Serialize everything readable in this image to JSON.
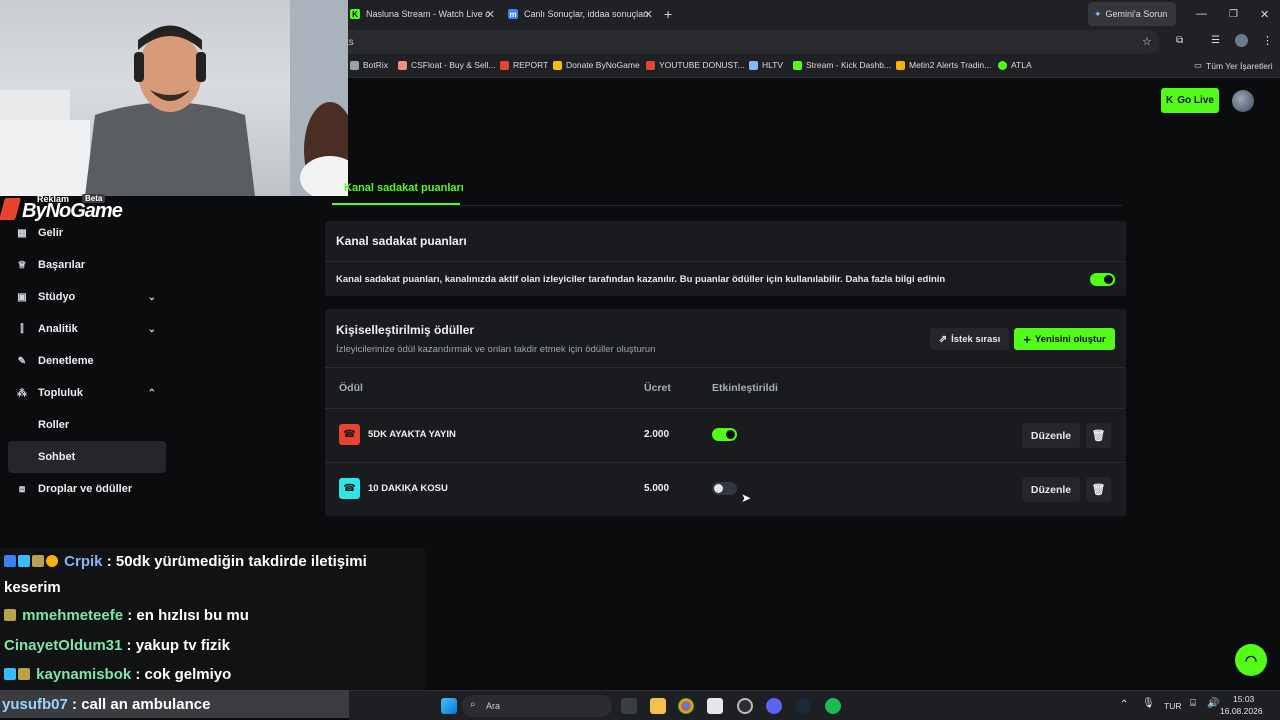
{
  "browser": {
    "tabs": [
      {
        "label": "Nasluna Stream - Watch Live o",
        "icon": "kick-icon"
      },
      {
        "label": "Canlı Sonuçlar, iddaa sonuçları",
        "icon": "m-icon"
      }
    ],
    "gemini_label": "Gemini'a Sorun",
    "url_text": "ts",
    "bookmarks": [
      "BotRix",
      "CSFloat - Buy & Sell...",
      "REPORT",
      "Donate ByNoGame",
      "YOUTUBE DONUST...",
      "HLTV",
      "Stream - Kick Dashb...",
      "Metin2 Alerts Tradin...",
      "ATLA"
    ],
    "all_bookmarks": "Tüm Yer İşaretleri"
  },
  "header": {
    "go_live": "Go Live"
  },
  "overlay": {
    "brand": "ByNoGame",
    "ad_label": "Reklam",
    "beta_label": "Beta"
  },
  "sidebar": {
    "items": [
      {
        "label": "Gelir",
        "icon": "chart-icon"
      },
      {
        "label": "Başarılar",
        "icon": "trophy-icon"
      },
      {
        "label": "Stüdyo",
        "icon": "studio-icon"
      },
      {
        "label": "Analitik",
        "icon": "analytics-icon"
      },
      {
        "label": "Denetleme",
        "icon": "wrench-icon"
      },
      {
        "label": "Topluluk",
        "icon": "community-icon"
      },
      {
        "label": "Roller"
      },
      {
        "label": "Sohbet"
      },
      {
        "label": "Droplar ve ödüller",
        "icon": "drops-icon"
      }
    ]
  },
  "page": {
    "tab_label": "Kanal sadakat puanları"
  },
  "loyalty": {
    "title": "Kanal sadakat puanları",
    "description": "Kanal sadakat puanları, kanalınızda aktif olan izleyiciler tarafından kazanılır. Bu puanlar ödüller için kullanılabilir. Daha fazla bilgi edinin",
    "enabled": true
  },
  "rewards": {
    "title": "Kişiselleştirilmiş ödüller",
    "subtitle": "İzleyicilerinize ödül kazandırmak ve onları takdir etmek için ödüller oluşturun",
    "queue_button": "İstek sırası",
    "create_button": "Yenisini oluştur",
    "columns": {
      "reward": "Ödül",
      "cost": "Ücret",
      "enabled": "Etkinleştirildi"
    },
    "edit_label": "Düzenle",
    "items": [
      {
        "name": "5DK AYAKTA YAYIN",
        "cost": "2.000",
        "enabled": true,
        "color": "#e8432f"
      },
      {
        "name": "10 DAKIKA KOSU",
        "cost": "5.000",
        "enabled": false,
        "color": "#2ee6e6"
      }
    ]
  },
  "chat": {
    "messages": [
      {
        "user": "Crpik",
        "text": ": 50dk yürümediğin takdirde iletişimi",
        "cont": "keserim"
      },
      {
        "user": "mmehmeteefe",
        "text": ": en hızlısı bu mu"
      },
      {
        "user": "CinayetOldum31",
        "text": ": yakup tv fizik"
      },
      {
        "user": "kaynamisbok",
        "text": ": cok gelmiyo"
      },
      {
        "user": "yusufb07",
        "text": ": call an ambulance"
      }
    ]
  },
  "taskbar": {
    "search_placeholder": "Ara",
    "lang": "TUR",
    "time": "15:03",
    "date": "16.08.2026"
  },
  "colors": {
    "accent": "#53fc18",
    "background": "#0b0c0e",
    "card": "#191b1f"
  }
}
